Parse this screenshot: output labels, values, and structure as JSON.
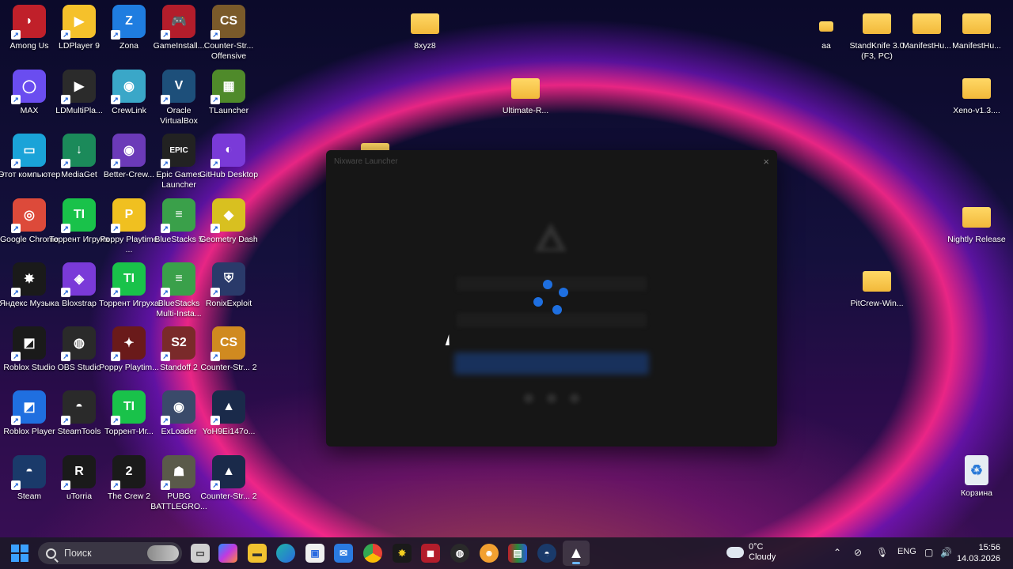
{
  "desktop_icons_left": [
    {
      "name": "among-us",
      "label": "Among Us",
      "color": "#c0202a",
      "glyph": "◗"
    },
    {
      "name": "ldplayer",
      "label": "LDPlayer 9",
      "color": "#f5c12b",
      "glyph": "▶"
    },
    {
      "name": "zona",
      "label": "Zona",
      "color": "#1f7de0",
      "glyph": "Z"
    },
    {
      "name": "gameinstaller",
      "label": "GameInstall...",
      "color": "#b31d2b",
      "glyph": "🎮"
    },
    {
      "name": "cs-offensive",
      "label": "Counter-Str... Offensive",
      "color": "#7a5a2a",
      "glyph": "CS"
    },
    {
      "name": "max",
      "label": "MAX",
      "color": "#6a4df0",
      "glyph": "◯"
    },
    {
      "name": "ldmultiplayer",
      "label": "LDMultiPla...",
      "color": "#2b2b2b",
      "glyph": "▶"
    },
    {
      "name": "crewlink",
      "label": "CrewLink",
      "color": "#3aa7c8",
      "glyph": "◉"
    },
    {
      "name": "virtualbox",
      "label": "Oracle VirtualBox",
      "color": "#1d4f7a",
      "glyph": "V"
    },
    {
      "name": "tlauncher",
      "label": "TLauncher",
      "color": "#4f8a2a",
      "glyph": "▦"
    },
    {
      "name": "this-pc",
      "label": "Этот компьютер",
      "color": "#1aa3d8",
      "glyph": "▭"
    },
    {
      "name": "mediaget",
      "label": "MediaGet",
      "color": "#1b8a5a",
      "glyph": "↓"
    },
    {
      "name": "better-crewlink",
      "label": "Better-Crew...",
      "color": "#6b3ab8",
      "glyph": "◉"
    },
    {
      "name": "epic-games",
      "label": "Epic Games Launcher",
      "color": "#222222",
      "glyph": "EPIC"
    },
    {
      "name": "github-desktop",
      "label": "GitHub Desktop",
      "color": "#7a3ad8",
      "glyph": "◐"
    },
    {
      "name": "chrome",
      "label": "Google Chrome",
      "color": "#dd4a3a",
      "glyph": "◎"
    },
    {
      "name": "torrent-igruha-1",
      "label": "Торрент Игруха",
      "color": "#19c24a",
      "glyph": "TI"
    },
    {
      "name": "poppy-playtime-1",
      "label": "Poppy Playtime ...",
      "color": "#f0c020",
      "glyph": "P"
    },
    {
      "name": "bluestacks5",
      "label": "BlueStacks 5",
      "color": "#3aa04a",
      "glyph": "≡"
    },
    {
      "name": "geometry-dash",
      "label": "Geometry Dash",
      "color": "#d8c020",
      "glyph": "◆"
    },
    {
      "name": "yandex-music",
      "label": "Яндекс Музыка",
      "color": "#1a1a1a",
      "glyph": "✸"
    },
    {
      "name": "bloxstrap",
      "label": "Bloxstrap",
      "color": "#7a3ad8",
      "glyph": "◈"
    },
    {
      "name": "torrent-igruha-2",
      "label": "Торрент Игруха",
      "color": "#19c24a",
      "glyph": "TI"
    },
    {
      "name": "bluestacks-multi",
      "label": "BlueStacks Multi-Insta...",
      "color": "#3aa04a",
      "glyph": "≡"
    },
    {
      "name": "ronixexploit",
      "label": "RonixExploit",
      "color": "#2a3a6a",
      "glyph": "⛨"
    },
    {
      "name": "roblox-studio",
      "label": "Roblox Studio",
      "color": "#1a1a1a",
      "glyph": "◩"
    },
    {
      "name": "obs-studio",
      "label": "OBS Studio",
      "color": "#2a2a2a",
      "glyph": "◍"
    },
    {
      "name": "poppy-playtime-2",
      "label": "Poppy Playtim...",
      "color": "#6a1a1a",
      "glyph": "✦"
    },
    {
      "name": "standoff2",
      "label": "Standoff 2",
      "color": "#7a2a2a",
      "glyph": "S2"
    },
    {
      "name": "cs2-1",
      "label": "Counter-Str... 2",
      "color": "#d08a20",
      "glyph": "CS"
    },
    {
      "name": "roblox-player",
      "label": "Roblox Player",
      "color": "#1f6fe0",
      "glyph": "◩"
    },
    {
      "name": "steamtools",
      "label": "SteamTools",
      "color": "#2a2a2a",
      "glyph": "◓"
    },
    {
      "name": "torrent-igruha-3",
      "label": "Торрент-Иг...",
      "color": "#19c24a",
      "glyph": "TI"
    },
    {
      "name": "exloader",
      "label": "ExLoader",
      "color": "#3a4a6a",
      "glyph": "◉"
    },
    {
      "name": "yoh-exe",
      "label": "YoH9Ei147o...",
      "color": "#1a2a4a",
      "glyph": "▲"
    },
    {
      "name": "steam",
      "label": "Steam",
      "color": "#1a3a6a",
      "glyph": "◓"
    },
    {
      "name": "utorria",
      "label": "uTorria",
      "color": "#1a1a1a",
      "glyph": "R"
    },
    {
      "name": "the-crew-2",
      "label": "The Crew 2",
      "color": "#1a1a1a",
      "glyph": "2"
    },
    {
      "name": "pubg",
      "label": "PUBG BATTLEGRO...",
      "color": "#5a5a4a",
      "glyph": "☗"
    },
    {
      "name": "cs2-2",
      "label": "Counter-Str... 2",
      "color": "#1a2a4a",
      "glyph": "▲"
    }
  ],
  "folders": [
    {
      "name": "folder-8xyz8",
      "label": "8xyz8"
    },
    {
      "name": "folder-ultimate",
      "label": "Ultimate-R..."
    },
    {
      "name": "folder-aa",
      "label": "aa"
    },
    {
      "name": "folder-standknife",
      "label": "StandKnife 3.0 (F3, PC)"
    },
    {
      "name": "folder-manifesthub-1",
      "label": "ManifestHu..."
    },
    {
      "name": "folder-manifesthub-2",
      "label": "ManifestHu..."
    },
    {
      "name": "folder-xeno",
      "label": "Xeno-v1.3...."
    },
    {
      "name": "folder-nightly",
      "label": "Nightly Release"
    },
    {
      "name": "folder-pitcrew",
      "label": "PitCrew-Win..."
    }
  ],
  "recycle_bin": {
    "label": "Корзина"
  },
  "launcher": {
    "title": "Nixware Launcher",
    "close_glyph": "×"
  },
  "taskbar": {
    "search_placeholder": "Поиск",
    "weather_temp": "0°C",
    "weather_desc": "Cloudy",
    "language": "ENG",
    "time": "15:56",
    "date": "14.03.2026"
  }
}
